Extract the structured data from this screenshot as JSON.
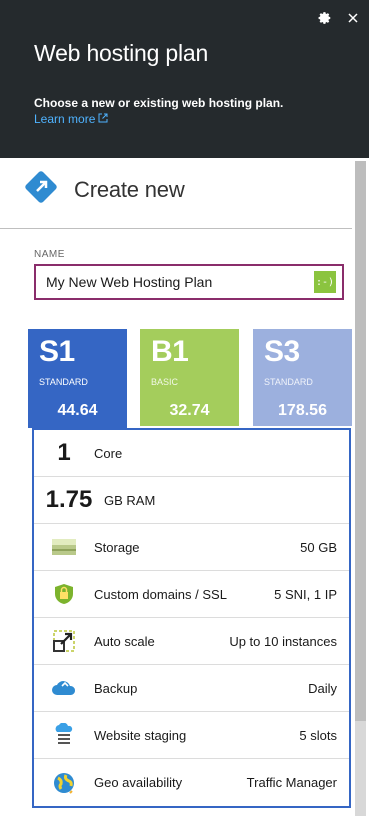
{
  "header": {
    "title": "Web hosting plan",
    "description": "Choose a new or existing web hosting plan.",
    "learn_more": "Learn more"
  },
  "create": {
    "label": "Create new"
  },
  "name_field": {
    "label": "NAME",
    "value": "My New Web Hosting Plan"
  },
  "tiers": [
    {
      "code": "S1",
      "tier": "STANDARD",
      "price": "44.64",
      "color": "#3566c4",
      "selected": true
    },
    {
      "code": "B1",
      "tier": "BASIC",
      "price": "32.74",
      "color": "#a4cd5c",
      "selected": false
    },
    {
      "code": "S3",
      "tier": "STANDARD",
      "price": "178.56",
      "color": "#9cb0de",
      "selected": false
    }
  ],
  "features": [
    {
      "big": "1",
      "name": "Core",
      "value": ""
    },
    {
      "big": "1.75",
      "name": "GB RAM",
      "value": ""
    },
    {
      "icon": "storage-icon",
      "name": "Storage",
      "value": "50 GB"
    },
    {
      "icon": "ssl-lock-icon",
      "name": "Custom domains / SSL",
      "value": "5 SNI, 1 IP"
    },
    {
      "icon": "auto-scale-icon",
      "name": "Auto scale",
      "value": "Up to 10 instances"
    },
    {
      "icon": "backup-cloud-icon",
      "name": "Backup",
      "value": "Daily"
    },
    {
      "icon": "staging-icon",
      "name": "Website staging",
      "value": "5 slots"
    },
    {
      "icon": "globe-icon",
      "name": "Geo availability",
      "value": "Traffic Manager"
    }
  ]
}
